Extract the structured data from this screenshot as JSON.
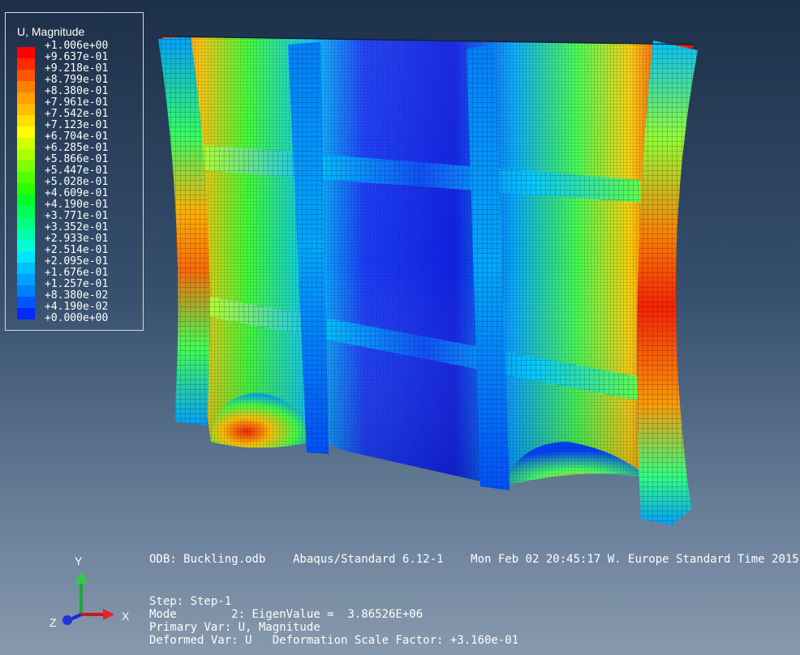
{
  "legend": {
    "title": "U, Magnitude",
    "entries": [
      {
        "value": "+1.006e+00",
        "color": "#ff0000"
      },
      {
        "value": "+9.637e-01",
        "color": "#ff2a00"
      },
      {
        "value": "+9.218e-01",
        "color": "#ff5500"
      },
      {
        "value": "+8.799e-01",
        "color": "#ff7f00"
      },
      {
        "value": "+8.380e-01",
        "color": "#ff9f00"
      },
      {
        "value": "+7.961e-01",
        "color": "#ffbf00"
      },
      {
        "value": "+7.542e-01",
        "color": "#ffdf00"
      },
      {
        "value": "+7.123e-01",
        "color": "#ffff00"
      },
      {
        "value": "+6.704e-01",
        "color": "#d4ff00"
      },
      {
        "value": "+6.285e-01",
        "color": "#aaff00"
      },
      {
        "value": "+5.866e-01",
        "color": "#7fff00"
      },
      {
        "value": "+5.447e-01",
        "color": "#55ff00"
      },
      {
        "value": "+5.028e-01",
        "color": "#2aff00"
      },
      {
        "value": "+4.609e-01",
        "color": "#00ff2a"
      },
      {
        "value": "+4.190e-01",
        "color": "#00ff55"
      },
      {
        "value": "+3.771e-01",
        "color": "#00ff7f"
      },
      {
        "value": "+3.352e-01",
        "color": "#00ffaa"
      },
      {
        "value": "+2.933e-01",
        "color": "#00ffd4"
      },
      {
        "value": "+2.514e-01",
        "color": "#00e5ff"
      },
      {
        "value": "+2.095e-01",
        "color": "#00bfff"
      },
      {
        "value": "+1.676e-01",
        "color": "#009fff"
      },
      {
        "value": "+1.257e-01",
        "color": "#007fff"
      },
      {
        "value": "+8.380e-02",
        "color": "#0055ff"
      },
      {
        "value": "+4.190e-02",
        "color": "#002aff"
      },
      {
        "value": "+0.000e+00",
        "color": "#0000ff"
      }
    ]
  },
  "info": {
    "odb_line": "ODB: Buckling.odb    Abaqus/Standard 6.12-1    Mon Feb 02 20:45:17 W. Europe Standard Time 2015",
    "step_line": "Step: Step-1",
    "mode_line": "Mode        2: EigenValue =  3.86526E+06",
    "primary_line": "Primary Var: U, Magnitude",
    "deformed_line": "Deformed Var: U   Deformation Scale Factor: +3.160e-01"
  },
  "triad": {
    "x": "X",
    "y": "Y",
    "z": "Z"
  },
  "colors": {
    "background_top": "#1d3049",
    "background_bottom": "#8799ad",
    "mesh_line": "#0b1a2e",
    "high": "#ff0000",
    "low": "#0000ff"
  }
}
